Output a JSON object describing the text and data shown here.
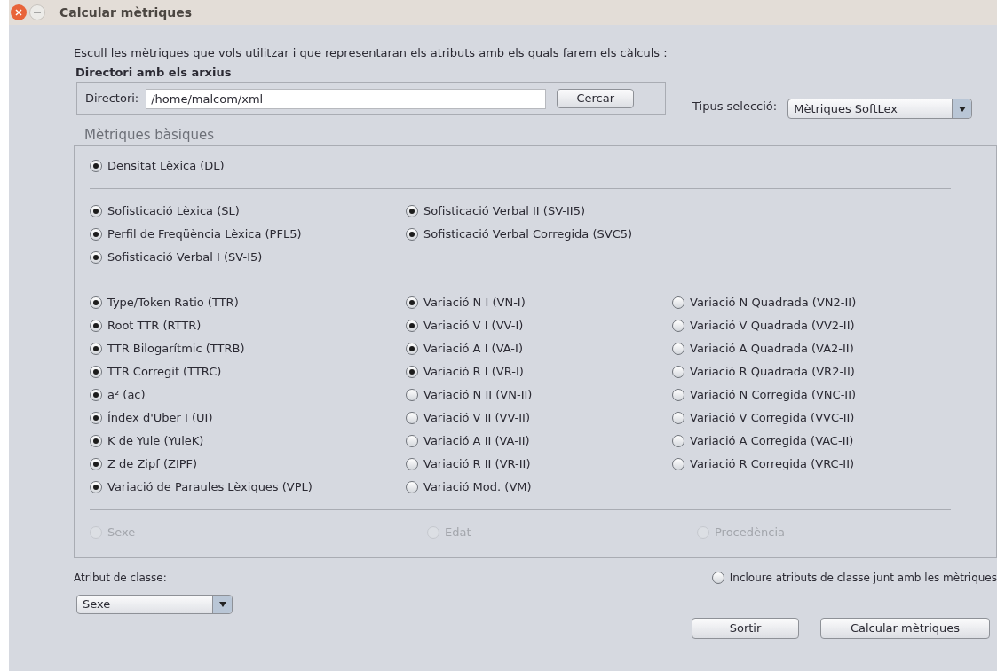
{
  "window": {
    "title": "Calcular mètriques"
  },
  "instructions": "Escull les mètriques que vols utilitzar i que representaran els atributs amb els quals farem els càlculs :",
  "directory_group": {
    "title": "Directori amb els arxius",
    "label": "Directori:",
    "value": "/home/malcom/xml",
    "button": "Cercar"
  },
  "selection_type": {
    "label": "Tipus selecció:",
    "value": "Mètriques SoftLex"
  },
  "metrics": {
    "title": "Mètriques bàsiques",
    "sections": [
      {
        "kind": "metrics",
        "columns": [
          [
            {
              "label": "Densitat Lèxica (DL)",
              "checked": true,
              "disabled": false
            }
          ]
        ]
      },
      {
        "kind": "metrics",
        "columns": [
          [
            {
              "label": "Sofisticació Lèxica (SL)",
              "checked": true,
              "disabled": false
            },
            {
              "label": "Perfil de Freqüència Lèxica (PFL5)",
              "checked": true,
              "disabled": false
            },
            {
              "label": "Sofisticació Verbal I (SV-I5)",
              "checked": true,
              "disabled": false
            }
          ],
          [
            {
              "label": "Sofisticació Verbal II (SV-II5)",
              "checked": true,
              "disabled": false
            },
            {
              "label": "Sofisticació Verbal Corregida (SVC5)",
              "checked": true,
              "disabled": false
            }
          ]
        ]
      },
      {
        "kind": "metrics",
        "columns": [
          [
            {
              "label": "Type/Token Ratio (TTR)",
              "checked": true,
              "disabled": false
            },
            {
              "label": "Root TTR (RTTR)",
              "checked": true,
              "disabled": false
            },
            {
              "label": "TTR Bilogarítmic (TTRB)",
              "checked": true,
              "disabled": false
            },
            {
              "label": "TTR Corregit (TTRC)",
              "checked": true,
              "disabled": false
            },
            {
              "label": "a² (ac)",
              "checked": true,
              "disabled": false
            },
            {
              "label": "Índex d'Uber I (UI)",
              "checked": true,
              "disabled": false
            },
            {
              "label": "K de Yule (YuleK)",
              "checked": true,
              "disabled": false
            },
            {
              "label": "Z de Zipf (ZIPF)",
              "checked": true,
              "disabled": false
            },
            {
              "label": "Variació de Paraules Lèxiques (VPL)",
              "checked": true,
              "disabled": false
            }
          ],
          [
            {
              "label": "Variació N I (VN-I)",
              "checked": true,
              "disabled": false
            },
            {
              "label": "Variació V I (VV-I)",
              "checked": true,
              "disabled": false
            },
            {
              "label": "Variació A I (VA-I)",
              "checked": true,
              "disabled": false
            },
            {
              "label": "Variació R I (VR-I)",
              "checked": true,
              "disabled": false
            },
            {
              "label": "Variació N II (VN-II)",
              "checked": false,
              "disabled": false
            },
            {
              "label": "Variació V II (VV-II)",
              "checked": false,
              "disabled": false
            },
            {
              "label": "Variació A II (VA-II)",
              "checked": false,
              "disabled": false
            },
            {
              "label": "Variació R II (VR-II)",
              "checked": false,
              "disabled": false
            },
            {
              "label": "Variació Mod. (VM)",
              "checked": false,
              "disabled": false
            }
          ],
          [
            {
              "label": "Variació N Quadrada (VN2-II)",
              "checked": false,
              "disabled": false
            },
            {
              "label": "Variació V Quadrada (VV2-II)",
              "checked": false,
              "disabled": false
            },
            {
              "label": "Variació A Quadrada (VA2-II)",
              "checked": false,
              "disabled": false
            },
            {
              "label": "Variació R Quadrada (VR2-II)",
              "checked": false,
              "disabled": false
            },
            {
              "label": "Variació N Corregida (VNC-II)",
              "checked": false,
              "disabled": false
            },
            {
              "label": "Variació V Corregida (VVC-II)",
              "checked": false,
              "disabled": false
            },
            {
              "label": "Variació A Corregida (VAC-II)",
              "checked": false,
              "disabled": false
            },
            {
              "label": "Variació R Corregida (VRC-II)",
              "checked": false,
              "disabled": false
            }
          ]
        ]
      },
      {
        "kind": "attributes",
        "columns": [
          [
            {
              "label": "Sexe",
              "checked": false,
              "disabled": true
            }
          ],
          [
            {
              "label": "Edat",
              "checked": false,
              "disabled": true
            }
          ],
          [
            {
              "label": "Procedència",
              "checked": false,
              "disabled": true
            }
          ]
        ]
      }
    ]
  },
  "class_attribute": {
    "label": "Atribut de classe:",
    "value": "Sexe"
  },
  "include_option": {
    "label": "Incloure atributs de classe junt amb les mètriques",
    "checked": false
  },
  "buttons": [
    "Sortir",
    "Calcular mètriques"
  ]
}
